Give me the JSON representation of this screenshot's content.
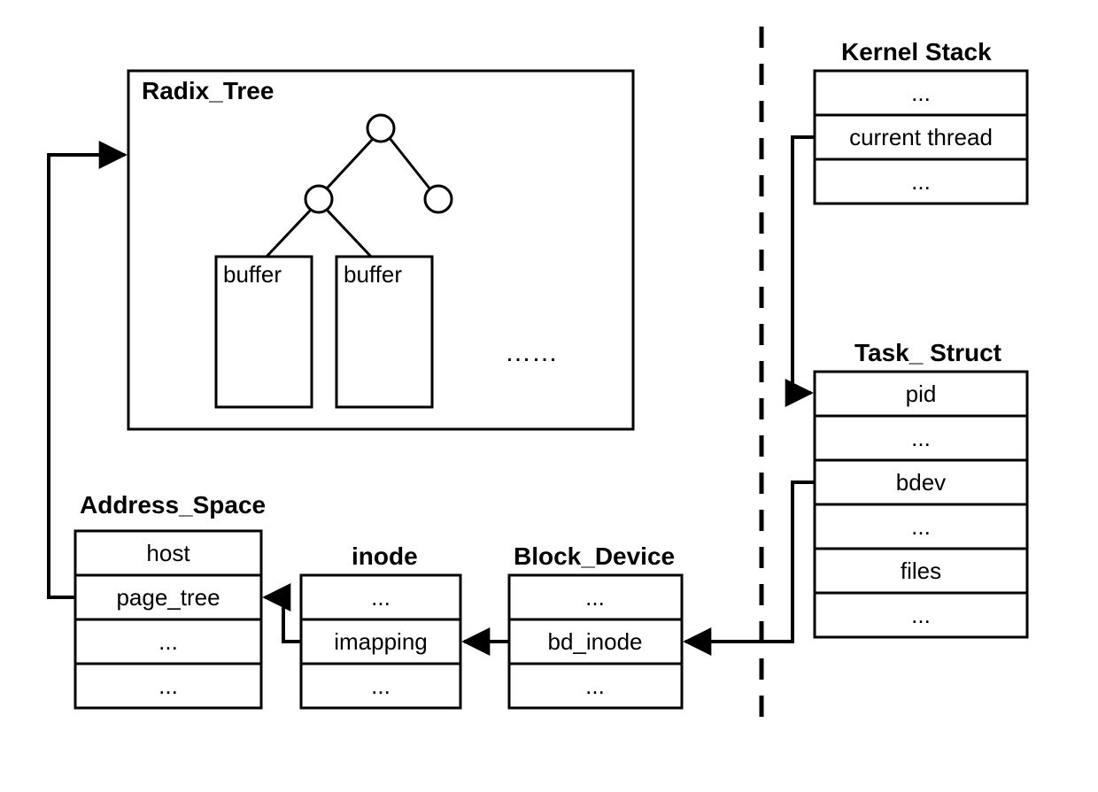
{
  "radix_tree": {
    "title": "Radix_Tree",
    "leaf_labels": [
      "buffer",
      "buffer"
    ],
    "more": "……"
  },
  "address_space": {
    "title": "Address_Space",
    "rows": [
      "host",
      "page_tree",
      "...",
      "..."
    ]
  },
  "inode": {
    "title": "inode",
    "rows": [
      "...",
      "imapping",
      "..."
    ]
  },
  "block_device": {
    "title": "Block_Device",
    "rows": [
      "...",
      "bd_inode",
      "..."
    ]
  },
  "kernel_stack": {
    "title": "Kernel Stack",
    "rows": [
      "...",
      "current thread",
      "..."
    ]
  },
  "task_struct": {
    "title": "Task_ Struct",
    "rows": [
      "pid",
      "...",
      "bdev",
      "...",
      "files",
      "..."
    ]
  }
}
